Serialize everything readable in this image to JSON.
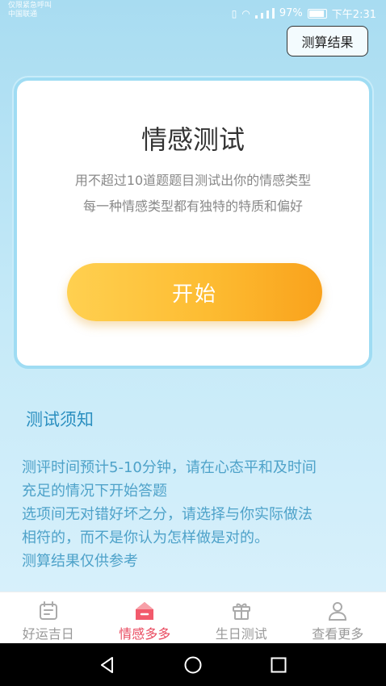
{
  "status_bar": {
    "left_line1": "仅限紧急呼叫",
    "left_line2": "中国联通",
    "battery": "97%",
    "time": "下午2:31"
  },
  "header": {
    "result_button": "测算结果"
  },
  "card": {
    "title": "情感测试",
    "desc_line1": "用不超过10道题题目测试出你的情感类型",
    "desc_line2": "每一种情感类型都有独特的特质和偏好",
    "start_button": "开始"
  },
  "notice": {
    "title": "测试须知",
    "lines": [
      "测评时间预计5-10分钟，请在心态平和及时间",
      "充足的情况下开始答题",
      "选项间无对错好坏之分，请选择与你实际做法",
      "相符的，而不是你认为怎样做是对的。",
      "测算结果仅供参考"
    ]
  },
  "bottom_nav": {
    "items": [
      {
        "label": "好运吉日",
        "icon": "calendar-icon",
        "active": false
      },
      {
        "label": "情感多多",
        "icon": "heart-house-icon",
        "active": true
      },
      {
        "label": "生日测试",
        "icon": "gift-icon",
        "active": false
      },
      {
        "label": "查看更多",
        "icon": "person-icon",
        "active": false
      }
    ]
  },
  "colors": {
    "accent": "#e94a5f",
    "start_button": "#fdbc32",
    "notice_text": "#4ea2c9",
    "background": "#bfe6f7"
  }
}
